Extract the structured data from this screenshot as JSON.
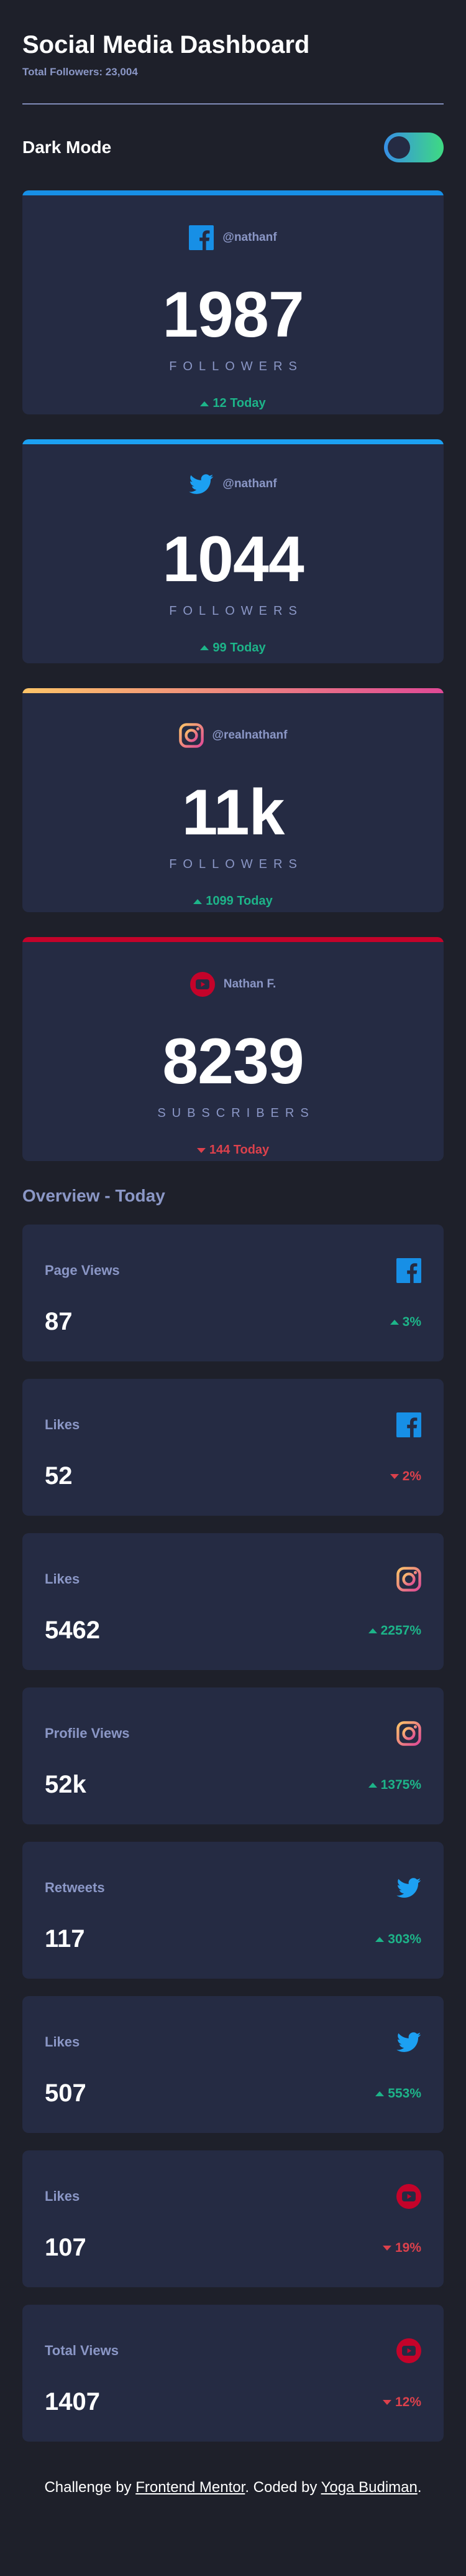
{
  "header": {
    "title": "Social Media Dashboard",
    "total_followers": "Total Followers: 23,004",
    "mode_label": "Dark Mode"
  },
  "colors": {
    "facebook": "#178fe6",
    "twitter": "#1ca0f2",
    "instagram_start": "#fdc468",
    "instagram_end": "#df4996",
    "youtube": "#c4032a",
    "up": "#1db489",
    "down": "#dc414c"
  },
  "cards": [
    {
      "network": "facebook",
      "icon": "facebook-icon",
      "handle": "@nathanf",
      "count": "1987",
      "label": "FOLLOWERS",
      "change": "12 Today",
      "direction": "up"
    },
    {
      "network": "twitter",
      "icon": "twitter-icon",
      "handle": "@nathanf",
      "count": "1044",
      "label": "FOLLOWERS",
      "change": "99 Today",
      "direction": "up"
    },
    {
      "network": "instagram",
      "icon": "instagram-icon",
      "handle": "@realnathanf",
      "count": "11k",
      "label": "FOLLOWERS",
      "change": "1099 Today",
      "direction": "up"
    },
    {
      "network": "youtube",
      "icon": "youtube-icon",
      "handle": "Nathan F.",
      "count": "8239",
      "label": "SUBSCRIBERS",
      "change": "144 Today",
      "direction": "down"
    }
  ],
  "overview": {
    "title": "Overview - Today",
    "items": [
      {
        "label": "Page Views",
        "icon": "facebook-icon",
        "value": "87",
        "change": "3%",
        "direction": "up"
      },
      {
        "label": "Likes",
        "icon": "facebook-icon",
        "value": "52",
        "change": "2%",
        "direction": "down"
      },
      {
        "label": "Likes",
        "icon": "instagram-icon",
        "value": "5462",
        "change": "2257%",
        "direction": "up"
      },
      {
        "label": "Profile Views",
        "icon": "instagram-icon",
        "value": "52k",
        "change": "1375%",
        "direction": "up"
      },
      {
        "label": "Retweets",
        "icon": "twitter-icon",
        "value": "117",
        "change": "303%",
        "direction": "up"
      },
      {
        "label": "Likes",
        "icon": "twitter-icon",
        "value": "507",
        "change": "553%",
        "direction": "up"
      },
      {
        "label": "Likes",
        "icon": "youtube-icon",
        "value": "107",
        "change": "19%",
        "direction": "down"
      },
      {
        "label": "Total Views",
        "icon": "youtube-icon",
        "value": "1407",
        "change": "12%",
        "direction": "down"
      }
    ]
  },
  "footer": {
    "prefix": "Challenge by ",
    "link1": "Frontend Mentor",
    "middle": ". Coded by ",
    "link2": "Yoga Budiman",
    "suffix": "."
  }
}
